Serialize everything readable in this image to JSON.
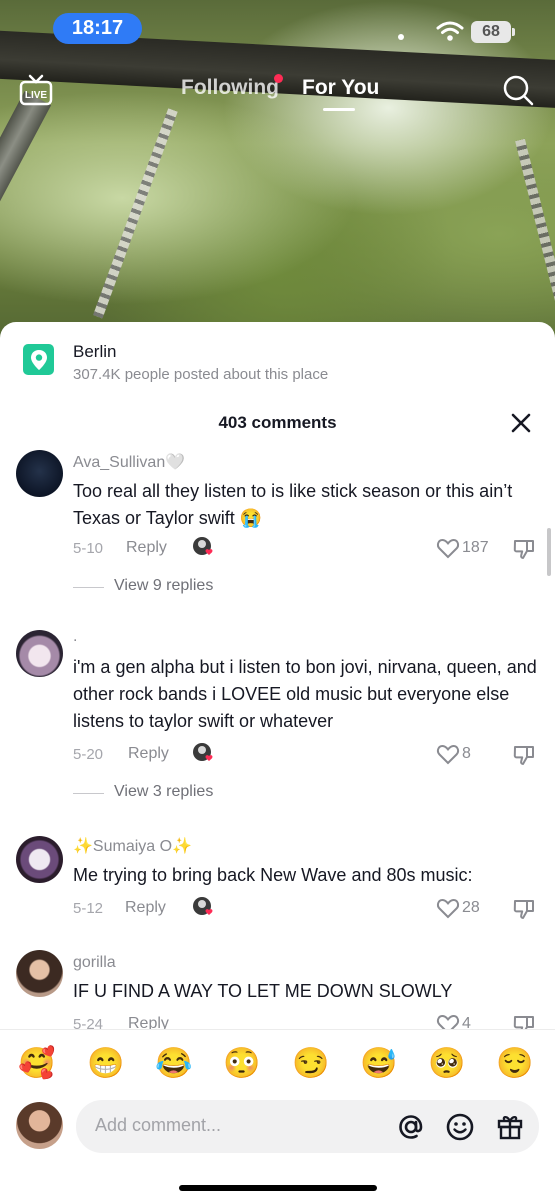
{
  "status": {
    "time": "18:17",
    "battery": "68"
  },
  "nav": {
    "live_label": "LIVE",
    "tabs": [
      {
        "label": "Following"
      },
      {
        "label": "For You"
      }
    ],
    "active_tab": "For You"
  },
  "place": {
    "name": "Berlin",
    "subtitle": "307.4K people posted about this place"
  },
  "comments_header": {
    "count_label": "403 comments"
  },
  "comments": [
    {
      "user": "Ava_Sullivan🤍",
      "text": "Too real all they listen to is like stick season or this ain’t Texas or Taylor swift 😭",
      "date": "5-10",
      "reply_label": "Reply",
      "likes": "187",
      "view_replies": "View 9 replies"
    },
    {
      "user": ".",
      "text": "i'm a gen alpha but i listen to bon jovi, nirvana, queen, and other rock bands i LOVEE old music but everyone else listens to taylor swift or whatever",
      "date": "5-20",
      "reply_label": "Reply",
      "likes": "8",
      "view_replies": "View 3 replies"
    },
    {
      "user": "✨Sumaiya O✨",
      "text": "Me trying to bring back New Wave and 80s music:",
      "date": "5-12",
      "reply_label": "Reply",
      "likes": "28"
    },
    {
      "user": "gorilla",
      "text": "IF U FIND A WAY TO LET ME DOWN SLOWLY",
      "date": "5-24",
      "reply_label": "Reply",
      "likes": "4"
    }
  ],
  "emoji_bar": [
    "🥰",
    "😁",
    "😂",
    "😳",
    "😏",
    "😅",
    "🥺",
    "😌"
  ],
  "composer": {
    "placeholder": "Add comment..."
  },
  "colors": {
    "accent_red": "#fe2c55",
    "time_pill": "#2f7bf6",
    "place_pin": "#20c997"
  }
}
